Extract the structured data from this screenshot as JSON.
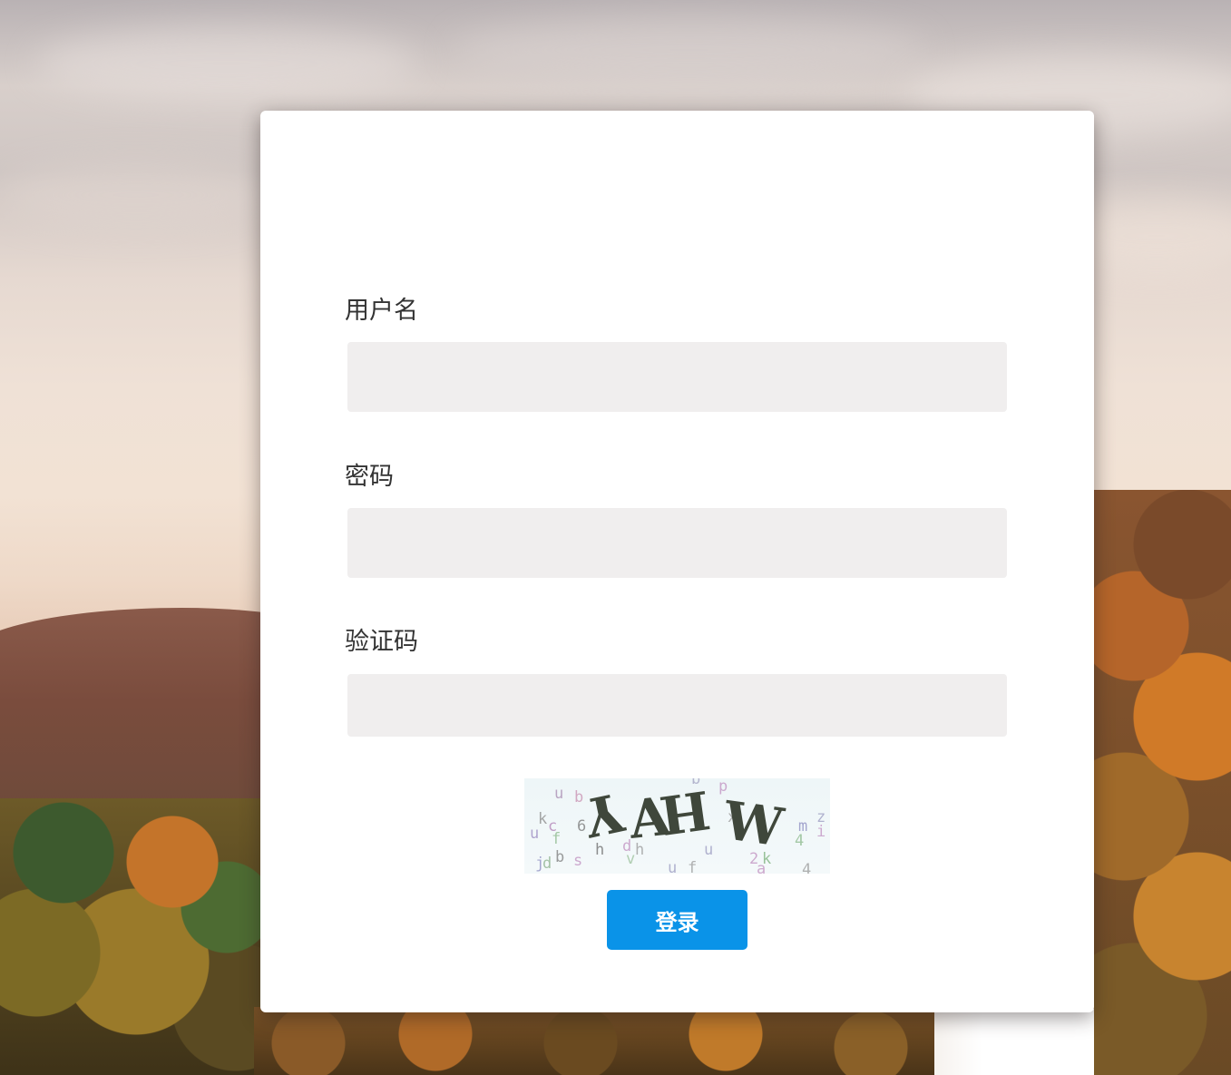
{
  "form": {
    "username_label": "用户名",
    "username_value": "",
    "password_label": "密码",
    "password_value": "",
    "captcha_label": "验证码",
    "captcha_value": "",
    "captcha_text": "YAHW",
    "login_button": "登录"
  },
  "colors": {
    "button": "#0a93e8",
    "input_bg": "#f0eeee",
    "label_text": "#333333"
  }
}
